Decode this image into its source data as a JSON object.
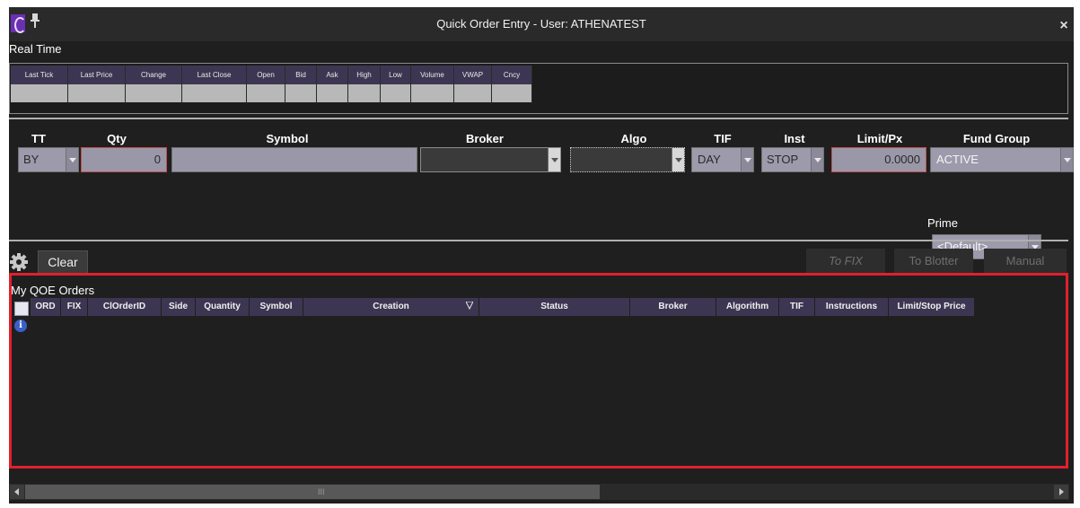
{
  "window": {
    "title": "Quick Order Entry - User: ATHENATEST"
  },
  "realtime": {
    "title": "Real Time",
    "columns": [
      "Last Tick",
      "Last Price",
      "Change",
      "Last Close",
      "Open",
      "Bid",
      "Ask",
      "High",
      "Low",
      "Volume",
      "VWAP",
      "Cncy"
    ]
  },
  "order_form": {
    "headers": {
      "tt": "TT",
      "qty": "Qty",
      "symbol": "Symbol",
      "broker": "Broker",
      "algo": "Algo",
      "tif": "TIF",
      "inst": "Inst",
      "limit": "Limit/Px",
      "fund_group": "Fund Group"
    },
    "values": {
      "tt": "BY",
      "qty": "0",
      "symbol": "",
      "broker": "",
      "algo": "",
      "tif": "DAY",
      "inst": "STOP",
      "limit": "0.0000",
      "fund_group": "ACTIVE"
    },
    "prime": {
      "label": "Prime",
      "value": "<Default>"
    }
  },
  "toolbar": {
    "clear": "Clear",
    "to_fix": "To FIX",
    "to_blotter": "To Blotter",
    "manual": "Manual"
  },
  "orders": {
    "title": "My QOE Orders",
    "columns": [
      "ORD",
      "FIX",
      "ClOrderID",
      "Side",
      "Quantity",
      "Symbol",
      "Creation",
      "Status",
      "Broker",
      "Algorithm",
      "TIF",
      "Instructions",
      "Limit/Stop Price"
    ]
  },
  "scrollbar": {
    "grip": "III"
  },
  "colors": {
    "header_bg": "#3d3652",
    "highlight_border": "#e0202d",
    "window_bg": "#1f1f1f",
    "app_icon": "#6b2fb3"
  }
}
